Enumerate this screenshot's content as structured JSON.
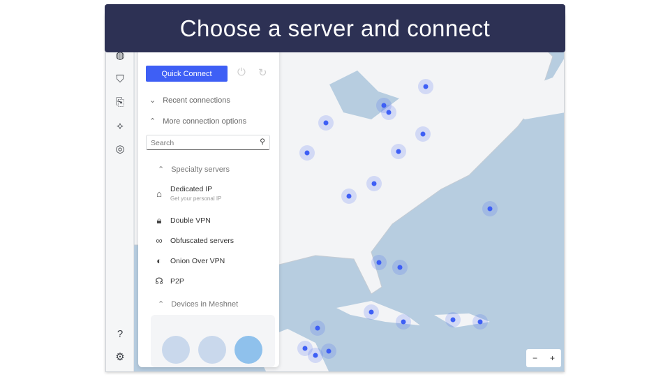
{
  "banner": {
    "title": "Choose a server and connect"
  },
  "panel": {
    "quick_connect": "Quick Connect",
    "recent": "Recent connections",
    "more": "More connection options",
    "search_placeholder": "Search",
    "specialty": "Specialty servers",
    "items": [
      {
        "label": "Dedicated IP",
        "sub": "Get your personal IP",
        "icon": "house-icon"
      },
      {
        "label": "Double VPN",
        "icon": "double-lock-icon"
      },
      {
        "label": "Obfuscated servers",
        "icon": "incognito-icon"
      },
      {
        "label": "Onion Over VPN",
        "icon": "onion-icon"
      },
      {
        "label": "P2P",
        "icon": "p2p-icon"
      }
    ],
    "meshnet": "Devices in Meshnet"
  },
  "map": {
    "zoom_out": "−",
    "zoom_in": "+",
    "ocean": "#b7cde0",
    "land": "#f3f4f6",
    "dot": "#3e5ff5"
  },
  "colors": {
    "accent": "#3e5ff5",
    "banner": "#2d3154"
  }
}
